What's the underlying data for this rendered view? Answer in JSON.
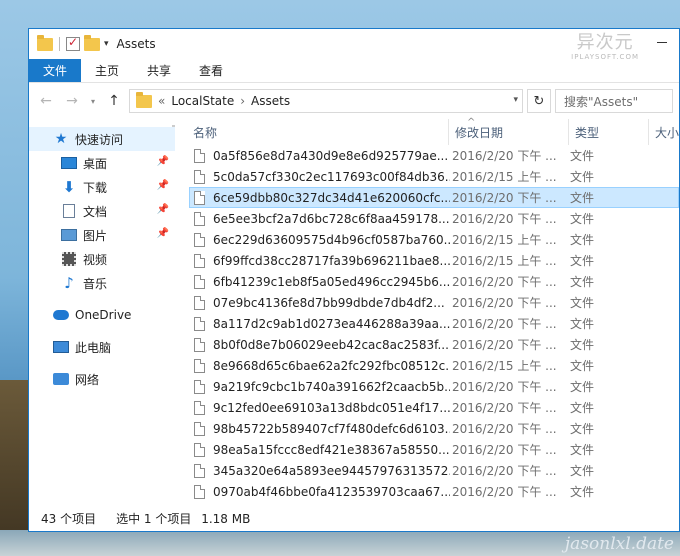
{
  "window": {
    "title": "Assets",
    "brand_main": "异次元",
    "brand_sub": "IPLAYSOFT.COM"
  },
  "ribbon": {
    "tabs": [
      "文件",
      "主页",
      "共享",
      "查看"
    ]
  },
  "address": {
    "prefix": "«",
    "crumbs": [
      "LocalState",
      "Assets"
    ],
    "search_placeholder": "搜索\"Assets\""
  },
  "nav": {
    "quick_access": "快速访问",
    "items": [
      {
        "label": "桌面",
        "icon": "desktop-icon"
      },
      {
        "label": "下载",
        "icon": "download-icon"
      },
      {
        "label": "文档",
        "icon": "document-icon"
      },
      {
        "label": "图片",
        "icon": "picture-icon"
      },
      {
        "label": "视频",
        "icon": "video-icon"
      },
      {
        "label": "音乐",
        "icon": "music-icon"
      }
    ],
    "onedrive": "OneDrive",
    "this_pc": "此电脑",
    "network": "网络"
  },
  "columns": {
    "name": "名称",
    "date": "修改日期",
    "type": "类型",
    "size": "大小"
  },
  "files": [
    {
      "name": "0a5f856e8d7a430d9e8e6d925779ae...",
      "date": "2016/2/20 下午 ...",
      "type": "文件"
    },
    {
      "name": "5c0da57cf330c2ec117693c00f84db36...",
      "date": "2016/2/15 上午 ...",
      "type": "文件"
    },
    {
      "name": "6ce59dbb80c327dc34d41e620060cfc...",
      "date": "2016/2/20 下午 ...",
      "type": "文件",
      "selected": true
    },
    {
      "name": "6e5ee3bcf2a7d6bc728c6f8aa459178...",
      "date": "2016/2/20 下午 ...",
      "type": "文件"
    },
    {
      "name": "6ec229d63609575d4b96cf0587ba760...",
      "date": "2016/2/15 上午 ...",
      "type": "文件"
    },
    {
      "name": "6f99ffcd38cc28717fa39b696211bae8...",
      "date": "2016/2/15 上午 ...",
      "type": "文件"
    },
    {
      "name": "6fb41239c1eb8f5a05ed496cc2945b6...",
      "date": "2016/2/20 下午 ...",
      "type": "文件"
    },
    {
      "name": "07e9bc4136fe8d7bb99dbde7db4df2...",
      "date": "2016/2/20 下午 ...",
      "type": "文件"
    },
    {
      "name": "8a117d2c9ab1d0273ea446288a39aa...",
      "date": "2016/2/20 下午 ...",
      "type": "文件"
    },
    {
      "name": "8b0f0d8e7b06029eeb42cac8ac2583f...",
      "date": "2016/2/20 下午 ...",
      "type": "文件"
    },
    {
      "name": "8e9668d65c6bae62a2fc292fbc08512c...",
      "date": "2016/2/15 上午 ...",
      "type": "文件"
    },
    {
      "name": "9a219fc9cbc1b740a391662f2caacb5b...",
      "date": "2016/2/20 下午 ...",
      "type": "文件"
    },
    {
      "name": "9c12fed0ee69103a13d8bdc051e4f17...",
      "date": "2016/2/20 下午 ...",
      "type": "文件"
    },
    {
      "name": "98b45722b589407cf7f480defc6d6103...",
      "date": "2016/2/20 下午 ...",
      "type": "文件"
    },
    {
      "name": "98ea5a15fccc8edf421e38367a58550...",
      "date": "2016/2/20 下午 ...",
      "type": "文件"
    },
    {
      "name": "345a320e64a5893ee94457976313572...",
      "date": "2016/2/20 下午 ...",
      "type": "文件"
    },
    {
      "name": "0970ab4f46bbe0fa4123539703caa67...",
      "date": "2016/2/20 下午 ...",
      "type": "文件"
    }
  ],
  "status": {
    "count": "43 个项目",
    "selection": "选中 1 个项目",
    "size": "1.18 MB"
  },
  "desktop": {
    "watermark": "jasonlxl.date"
  }
}
